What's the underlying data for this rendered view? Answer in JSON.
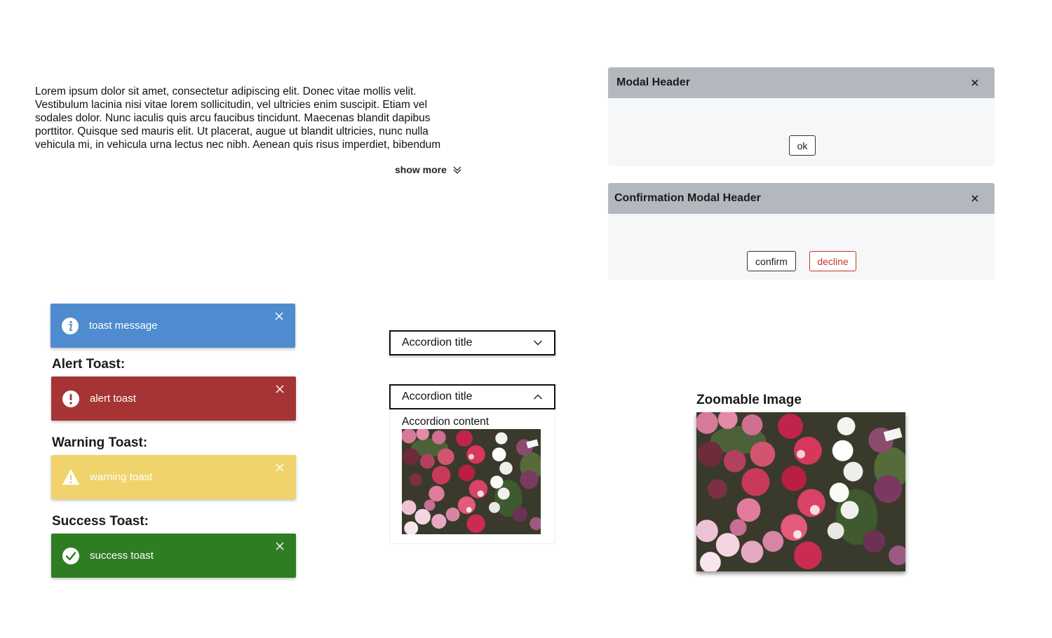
{
  "truncated_text": {
    "body": "Lorem ipsum dolor sit amet, consectetur adipiscing elit. Donec vitae mollis velit. Vestibulum lacinia nisi vitae lorem sollicitudin, vel ultricies enim suscipit. Etiam vel sodales dolor. Nunc iaculis quis arcu faucibus tincidunt. Maecenas blandit dapibus porttitor. Quisque sed mauris elit. Ut placerat, augue ut blandit ultricies, nunc nulla vehicula mi, in vehicula urna lectus nec nibh. Aenean quis risus imperdiet, bibendum",
    "show_more_label": "show more",
    "show_more_icon": "double-chevron-down-icon"
  },
  "modal": {
    "title": "Modal Header",
    "ok_label": "ok"
  },
  "confirmation_modal": {
    "title": "Confirmation Modal Header",
    "confirm_label": "confirm",
    "decline_label": "decline",
    "decline_color": "#c0392b"
  },
  "toasts": {
    "info": {
      "message": "toast message",
      "color": "#4f8ccf",
      "icon": "info-icon"
    },
    "alert": {
      "heading": "Alert Toast:",
      "message": "alert toast",
      "color": "#a63434",
      "icon": "exclamation-icon"
    },
    "warning": {
      "heading": "Warning Toast:",
      "message": "warning toast",
      "color": "#f0d36a",
      "icon": "warning-triangle-icon"
    },
    "success": {
      "heading": "Success Toast:",
      "message": "success toast",
      "color": "#2e7d23",
      "icon": "checkmark-icon"
    }
  },
  "accordions": [
    {
      "title": "Accordion title",
      "expanded": false
    },
    {
      "title": "Accordion title",
      "expanded": true,
      "content": "Accordion content"
    }
  ],
  "zoomable": {
    "title": "Zoomable Image"
  }
}
